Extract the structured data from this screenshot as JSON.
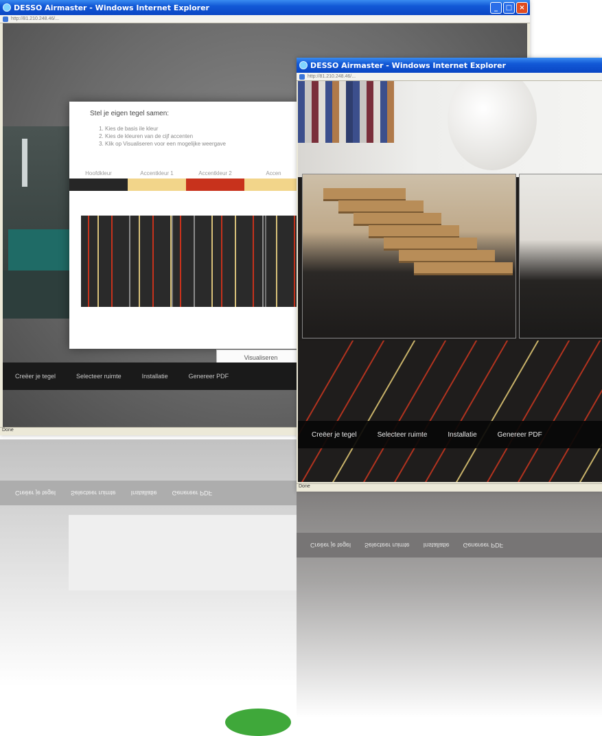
{
  "back_window": {
    "title": "DESSO Airmaster - Windows Internet Explorer",
    "address": "http://81.210.248.46/...",
    "status": "Done",
    "dialog": {
      "title": "Stel je eigen tegel samen:",
      "steps": [
        "Kies de basis ile kleur",
        "Kies de kleuren van de cijf accenten",
        "Klik op Visualiseren voor een mogelijke weergave"
      ],
      "color_labels": [
        "Hoofdkleur",
        "Accentkleur 1",
        "Accentkleur 2",
        "Accen"
      ],
      "swatch_colors": [
        "#262626",
        "#f2d58a",
        "#c8321c",
        "#f2d58a"
      ],
      "visualize_label": "Visualiseren"
    },
    "nav": [
      "Creëer je tegel",
      "Selecteer ruimte",
      "Installatie",
      "Genereer PDF"
    ]
  },
  "front_window": {
    "title": "DESSO Airmaster - Windows Internet Explorer",
    "address": "http://81.210.248.46/...",
    "status": "Done",
    "nav": [
      "Creëer je tegel",
      "Selecteer ruimte",
      "Installatie",
      "Genereer PDF"
    ]
  },
  "reflection": {
    "back_nav": [
      "Creëer je tegel",
      "Selecteer ruimte",
      "Installatie",
      "Genereer PDF"
    ],
    "front_nav": [
      "Creëer je tegel",
      "Selecteer ruimte",
      "Installatie",
      "Genereer PDF"
    ]
  }
}
